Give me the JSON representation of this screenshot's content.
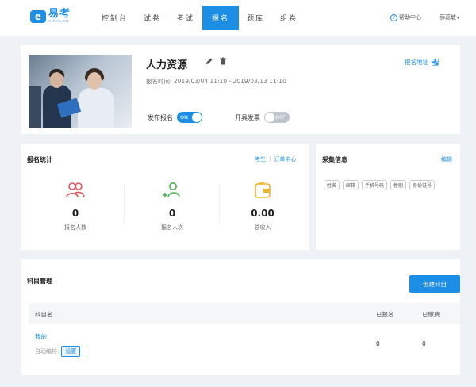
{
  "logo": {
    "mark": "e",
    "name": "易考",
    "sub": "ezksoi.org"
  },
  "nav": {
    "items": [
      "控制台",
      "试卷",
      "考试",
      "报名",
      "题库",
      "组卷"
    ],
    "active_index": 3
  },
  "header": {
    "help": "帮助中心",
    "user": "薛蕊敏"
  },
  "event": {
    "title": "人力资源",
    "time": "报名时间: 2019/03/04 11:10 - 2019/03/13 11:10",
    "reg_link": "报名地址",
    "publish_label": "发布报名",
    "publish_state": "ON",
    "open_payment_label": "开具发票",
    "open_payment_state": "OFF"
  },
  "stats": {
    "title": "报名统计",
    "link_candidates": "考生",
    "link_orders": "订单中心",
    "items": [
      {
        "value": "0",
        "label": "报名人数"
      },
      {
        "value": "0",
        "label": "报名人次"
      },
      {
        "value": "0.00",
        "label": "总收入"
      }
    ]
  },
  "collect": {
    "title": "采集信息",
    "edit": "编辑",
    "tags": [
      "姓名",
      "邮箱",
      "手机号码",
      "性别",
      "身份证号"
    ]
  },
  "subjects": {
    "title": "科目管理",
    "create": "创建科目",
    "columns": [
      "科目名",
      "已报名",
      "已缴费"
    ],
    "rows": [
      {
        "name": "我的",
        "auto_label": "自动编排:",
        "set_label": "设置",
        "registered": "0",
        "paid": "0"
      }
    ]
  },
  "colors": {
    "accent": "#1c8ee6",
    "people_icon": "#e0555a",
    "add_user_icon": "#4caf50",
    "wallet_icon": "#f0b429"
  }
}
